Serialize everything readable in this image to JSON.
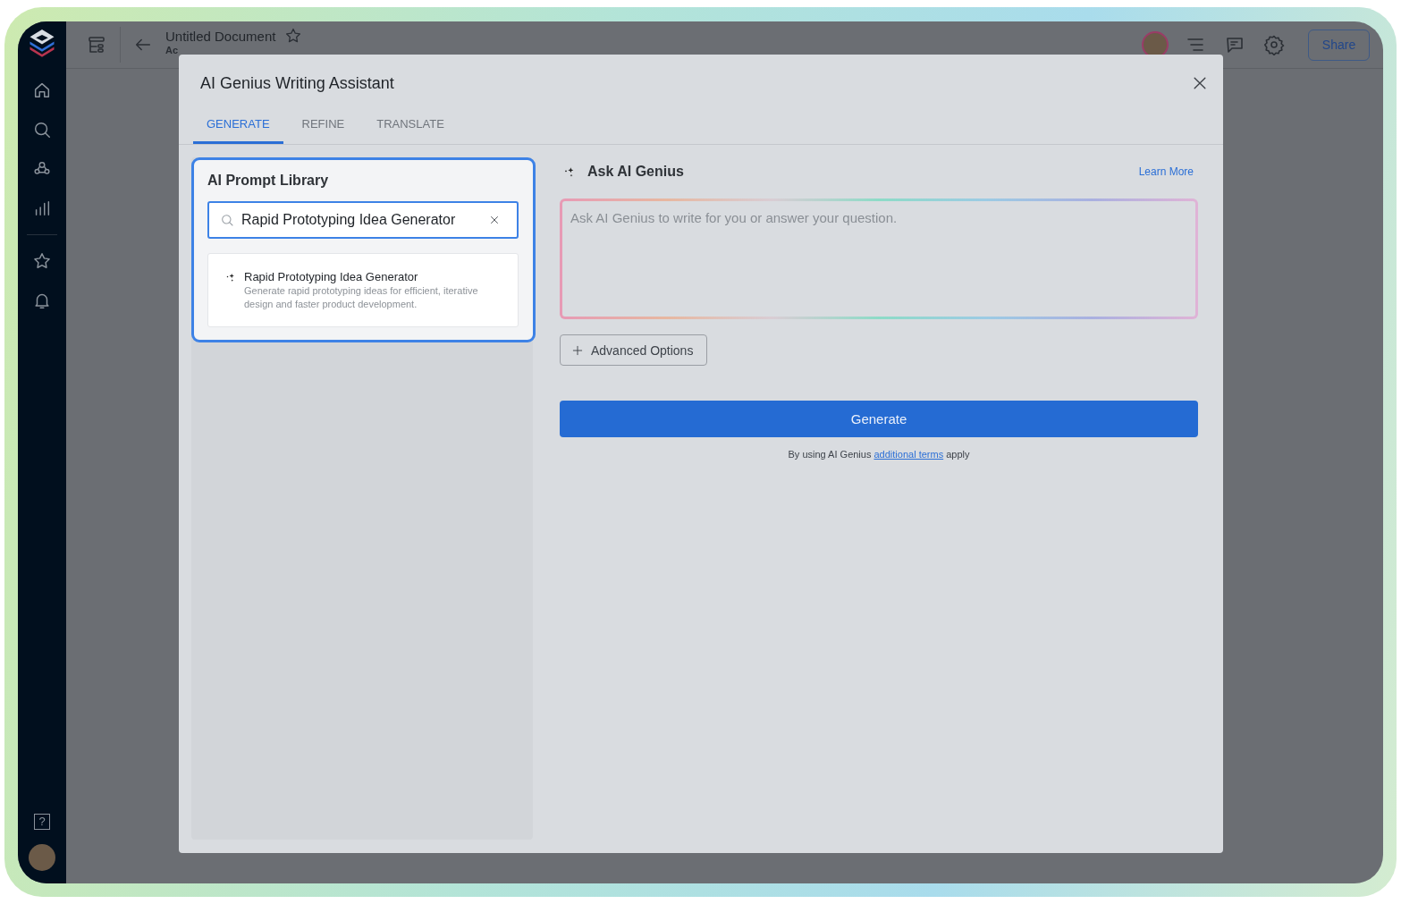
{
  "app": {
    "document_title": "Untitled Document",
    "document_subtitle": "Ac",
    "share_label": "Share",
    "help_label": "?"
  },
  "dialog": {
    "title": "AI Genius Writing Assistant",
    "tabs": [
      {
        "label": "GENERATE",
        "selected": true
      },
      {
        "label": "REFINE",
        "selected": false
      },
      {
        "label": "TRANSLATE",
        "selected": false
      }
    ],
    "library": {
      "title": "AI Prompt Library",
      "search_value": "Rapid Prototyping Idea Generator",
      "results": [
        {
          "title": "Rapid Prototyping Idea Generator",
          "description": "Generate rapid prototyping ideas for efficient, iterative design and faster product development."
        }
      ]
    },
    "ask": {
      "title": "Ask AI Genius",
      "learn_more": "Learn More",
      "placeholder": "Ask AI Genius to write for you or answer your question.",
      "advanced_label": "Advanced Options",
      "generate_label": "Generate",
      "terms_prefix": "By using AI Genius",
      "terms_link": "additional terms",
      "terms_suffix": "apply"
    }
  }
}
